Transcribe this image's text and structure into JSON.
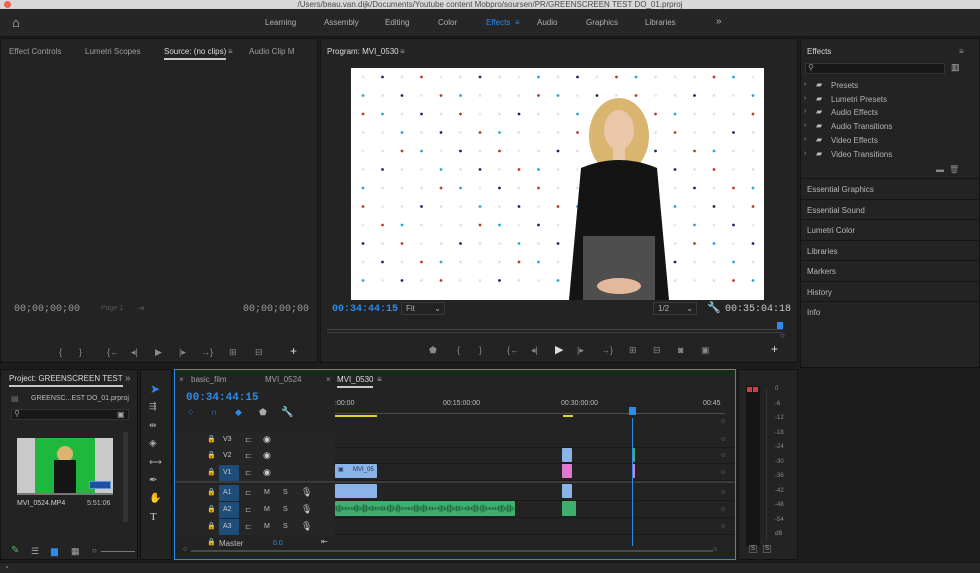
{
  "window": {
    "title": "/Users/beau.van.dijk/Documents/Youtube content Mobpro/soursen/PR/GREENSCREEN TEST DO_01.prproj"
  },
  "workspaces": [
    "Learning",
    "Assembly",
    "Editing",
    "Color",
    "Effects",
    "Audio",
    "Graphics",
    "Libraries"
  ],
  "active_workspace": "Effects",
  "source_panel": {
    "tabs": [
      "Effect Controls",
      "Lumetri Scopes",
      "Source: (no clips)",
      "Audio Clip M"
    ],
    "tc_in": "00;00;00;00",
    "page": "Page 1",
    "tc_out": "00;00;00;00"
  },
  "program": {
    "title": "Program: MVI_0530",
    "timecode": "00:34:44:15",
    "fit": "Fit",
    "resolution": "1/2",
    "duration": "00:35:04:18"
  },
  "effects_panel": {
    "title": "Effects",
    "search_placeholder": "",
    "tree": [
      "Presets",
      "Lumetri Presets",
      "Audio Effects",
      "Audio Transitions",
      "Video Effects",
      "Video Transitions"
    ],
    "sections": [
      "Essential Graphics",
      "Essential Sound",
      "Lumetri Color",
      "Libraries",
      "Markers",
      "History",
      "Info"
    ]
  },
  "project": {
    "title": "Project: GREENSCREEN TEST",
    "file": "GREENSC...EST DO_01.prproj",
    "clip_name": "MVI_0524.MP4",
    "clip_duration": "5:51:06"
  },
  "timeline": {
    "tabs": [
      "basic_film",
      "MVI_0524",
      "MVI_0530"
    ],
    "active_tab": "MVI_0530",
    "timecode": "00:34:44:15",
    "ruler": [
      ":00:00",
      "00:15:00:00",
      "00:30:00:00",
      "00:45"
    ],
    "video_tracks": [
      "V3",
      "V2",
      "V1"
    ],
    "audio_tracks": [
      "A1",
      "A2",
      "A3"
    ],
    "master_label": "Master",
    "master_value": "0.0",
    "clip_label": "MVI_05",
    "toggle_m": "M",
    "toggle_s": "S"
  },
  "meter": {
    "scale": [
      "0",
      "-6",
      "-12",
      "-18",
      "-24",
      "-30",
      "-36",
      "-42",
      "-48",
      "-54",
      "dB"
    ],
    "solo": "S"
  },
  "colors": {
    "accent": "#2d8ceb",
    "audio_clip": "#3fae6e",
    "video_clip": "#8ab4e8",
    "pink_clip": "#e07ad0"
  }
}
